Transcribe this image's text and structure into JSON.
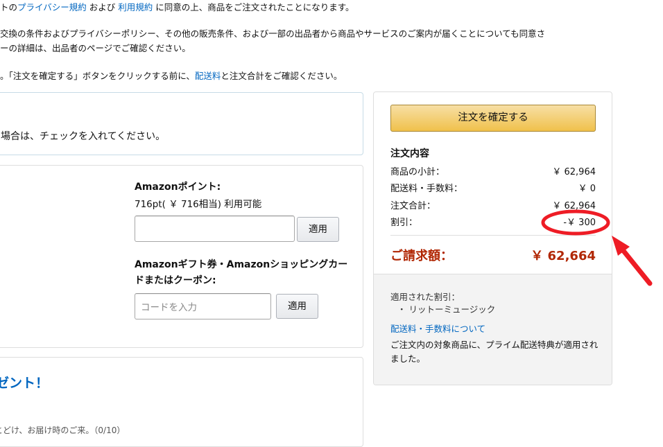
{
  "top": {
    "line1_prefix": "トの",
    "line1_link1": "プライバシー規約",
    "line1_mid": " および ",
    "line1_link2": "利用規約",
    "line1_suffix": " に同意の上、商品をご注文されたことになります。",
    "line2": "交換の条件およびプライバシーポリシー、その他の販売条件、および一部の出品者から商品やサービスのご案内が届くことについても同意さ",
    "line3": "ーの詳細は、出品者のページでご確認ください。",
    "line4_prefix": "。「注文を確定する」ボタンをクリックする前に、",
    "line4_link": "配送料",
    "line4_suffix": "と注文合計をご確認ください。"
  },
  "gift": {
    "text": "場合は、チェックを入れてください。"
  },
  "payment": {
    "points_title": "Amazonポイント:",
    "points_available": "716pt( ￥ 716相当) 利用可能",
    "points_apply": "適用",
    "gift_title": "Amazonギフト券・Amazonショッピングカードまたはクーポン:",
    "code_placeholder": "コードを入力",
    "code_apply": "適用"
  },
  "promo": {
    "title": "ゼント！",
    "subtitle": "とどけ、お届け時のご来。（0/10）"
  },
  "summary": {
    "place_order": "注文を確定する",
    "title": "注文内容",
    "rows": [
      {
        "label": "商品の小計：",
        "value": "￥ 62,964"
      },
      {
        "label": "配送料・手数料：",
        "value": "￥ 0"
      },
      {
        "label": "注文合計：",
        "value": "￥ 62,964"
      },
      {
        "label": "割引：",
        "value": "-￥ 300"
      }
    ],
    "grand_label": "ご請求額：",
    "grand_value": "￥ 62,664",
    "applied_label": "適用された割引：",
    "applied_item": "・ リットーミュージック",
    "shipping_link": "配送料・手数料について",
    "prime_note": "ご注文内の対象商品に、プライム配送特典が適用されました。"
  },
  "colors": {
    "annotation": "#ee1c25",
    "link": "#0066c0",
    "price": "#b12704",
    "button": "#f0c14b"
  }
}
